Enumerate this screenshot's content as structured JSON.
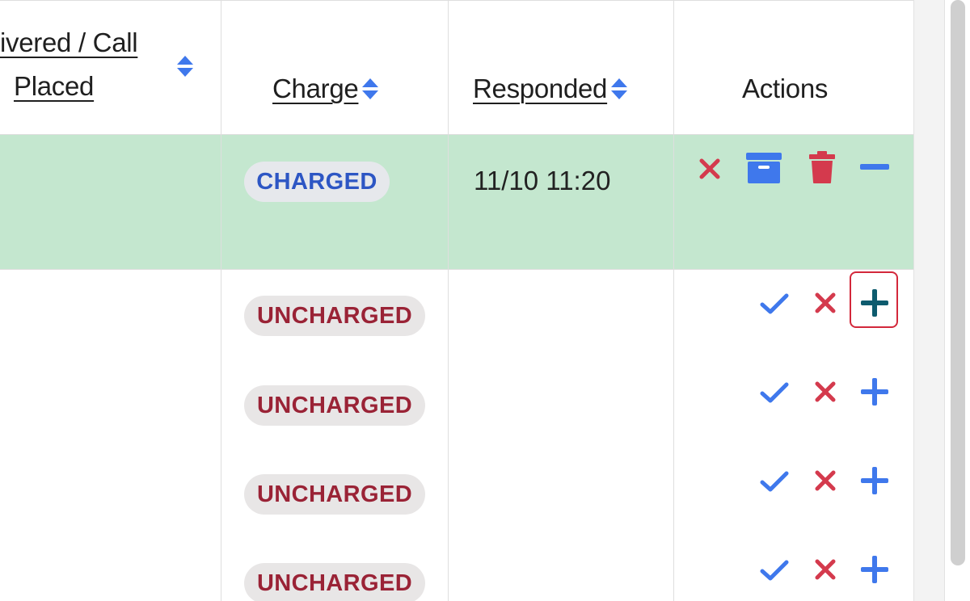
{
  "table": {
    "headers": {
      "delivered_line1": "ivered / Call",
      "delivered_line2": "Placed",
      "charge": "Charge",
      "responded": "Responded",
      "actions": "Actions"
    },
    "rows": [
      {
        "charge_status": "CHARGED",
        "responded": "11/10 11:20",
        "highlighted": true
      },
      {
        "charge_status": "UNCHARGED",
        "responded": "",
        "highlighted": false
      },
      {
        "charge_status": "UNCHARGED",
        "responded": "",
        "highlighted": false
      },
      {
        "charge_status": "UNCHARGED",
        "responded": "",
        "highlighted": false
      },
      {
        "charge_status": "UNCHARGED",
        "responded": "",
        "highlighted": false
      }
    ]
  },
  "icons": {
    "sort": "sort-icon",
    "reject": "close-icon",
    "archive": "archive-icon",
    "delete": "trash-icon",
    "collapse": "minus-icon",
    "accept": "check-icon",
    "expand": "plus-icon"
  },
  "colors": {
    "highlight_row": "#c4e7cf",
    "blue_icon": "#3f78ec",
    "red_icon": "#d43a4d",
    "dark_plus": "#0d5b6e",
    "focus_ring": "#d3283b"
  }
}
